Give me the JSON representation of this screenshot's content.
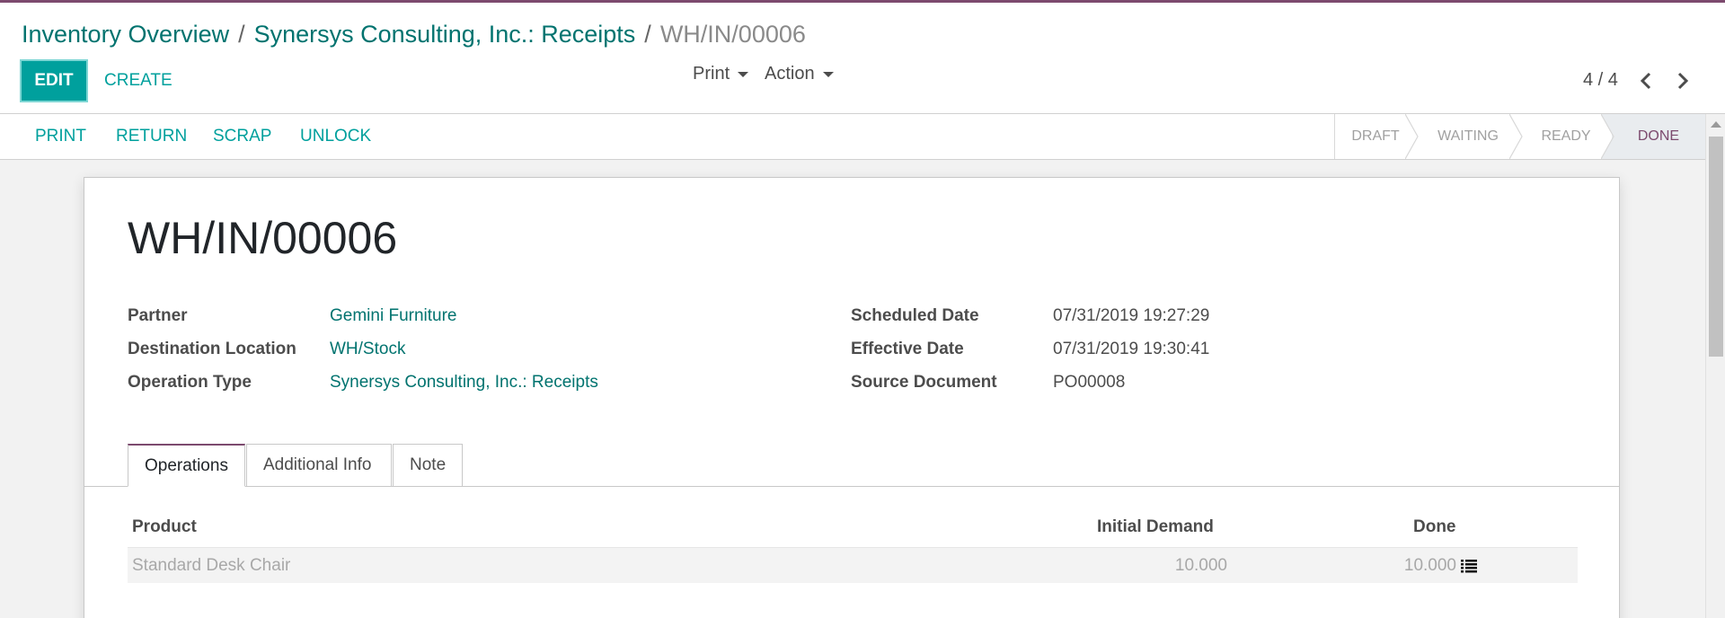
{
  "breadcrumb": {
    "items": [
      "Inventory Overview",
      "Synersys Consulting, Inc.: Receipts"
    ],
    "separator": "/",
    "current": "WH/IN/00006"
  },
  "toolbar": {
    "edit_label": "EDIT",
    "create_label": "CREATE",
    "print_label": "Print",
    "action_label": "Action"
  },
  "pager": {
    "value": "4 / 4"
  },
  "statusbar": {
    "buttons": [
      "PRINT",
      "RETURN",
      "SCRAP",
      "UNLOCK"
    ],
    "stages": [
      "DRAFT",
      "WAITING",
      "READY",
      "DONE"
    ],
    "active_stage": "DONE"
  },
  "record": {
    "title": "WH/IN/00006",
    "left_fields": [
      {
        "label": "Partner",
        "value": "Gemini Furniture"
      },
      {
        "label": "Destination Location",
        "value": "WH/Stock"
      },
      {
        "label": "Operation Type",
        "value": "Synersys Consulting, Inc.: Receipts"
      }
    ],
    "right_fields": [
      {
        "label": "Scheduled Date",
        "value": "07/31/2019 19:27:29"
      },
      {
        "label": "Effective Date",
        "value": "07/31/2019 19:30:41"
      },
      {
        "label": "Source Document",
        "value": "PO00008"
      }
    ]
  },
  "tabs": [
    "Operations",
    "Additional Info",
    "Note"
  ],
  "operations": {
    "columns": [
      "Product",
      "Initial Demand",
      "Done"
    ],
    "rows": [
      {
        "product": "Standard Desk Chair",
        "initial_demand": "10.000",
        "done": "10.000",
        "icon": "list-detail-icon"
      }
    ]
  },
  "colors": {
    "brand_teal": "#00a09d",
    "link": "#01736f",
    "accent_purple": "#7c4a6e"
  }
}
